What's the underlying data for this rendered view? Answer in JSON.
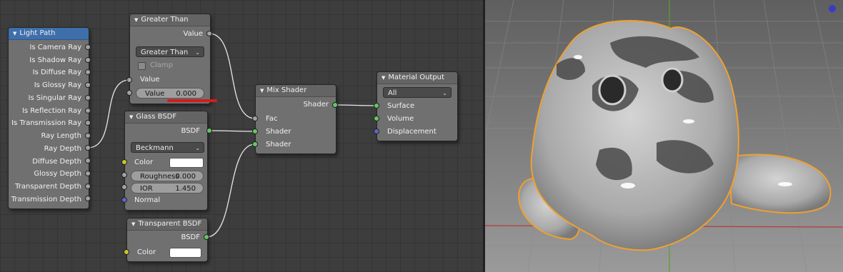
{
  "light_path": {
    "title": "Light Path",
    "outputs": [
      "Is Camera Ray",
      "Is Shadow Ray",
      "Is Diffuse Ray",
      "Is Glossy Ray",
      "Is Singular Ray",
      "Is Reflection Ray",
      "Is Transmission Ray",
      "Ray Length",
      "Ray Depth",
      "Diffuse Depth",
      "Glossy Depth",
      "Transparent Depth",
      "Transmission Depth"
    ]
  },
  "greater_than": {
    "title": "Greater Than",
    "output": "Value",
    "operation": "Greater Than",
    "clamp_label": "Clamp",
    "input_value_label": "Value",
    "field_label": "Value",
    "field_value": "0.000"
  },
  "glass_bsdf": {
    "title": "Glass BSDF",
    "output": "BSDF",
    "distribution": "Beckmann",
    "color_label": "Color",
    "roughness_label": "Roughness",
    "roughness_value": "0.000",
    "ior_label": "IOR",
    "ior_value": "1.450",
    "normal_label": "Normal"
  },
  "transparent_bsdf": {
    "title": "Transparent BSDF",
    "output": "BSDF",
    "color_label": "Color"
  },
  "mix_shader": {
    "title": "Mix Shader",
    "output": "Shader",
    "inputs": [
      "Fac",
      "Shader",
      "Shader"
    ]
  },
  "material_output": {
    "title": "Material Output",
    "target": "All",
    "inputs": [
      "Surface",
      "Volume",
      "Displacement"
    ]
  },
  "colors": {
    "editor_bg": "#3d3d3d",
    "node_body": "#707070",
    "header_active": "#3f6fab",
    "socket_grey": "#a2a2a2",
    "socket_green": "#63c763",
    "socket_yellow": "#c7c729",
    "socket_blue": "#6363c7",
    "link": "#e8e8e8",
    "annotation_red": "#d51b1b",
    "selection_outline": "#f0a030"
  }
}
